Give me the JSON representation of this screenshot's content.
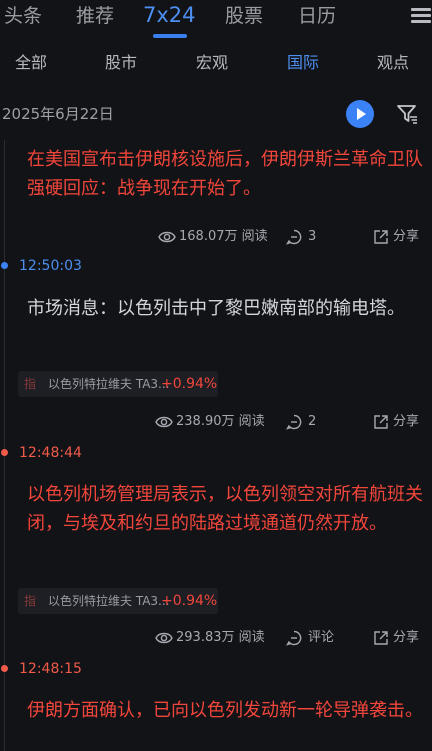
{
  "top_nav": {
    "tabs": [
      {
        "label": "头条",
        "active": false
      },
      {
        "label": "推荐",
        "active": false
      },
      {
        "label": "7x24",
        "active": true
      },
      {
        "label": "股票",
        "active": false
      },
      {
        "label": "日历",
        "active": false
      }
    ],
    "menu_icon": "hamburger-menu-icon"
  },
  "sub_nav": {
    "tabs": [
      {
        "label": "全部",
        "active": false
      },
      {
        "label": "股市",
        "active": false
      },
      {
        "label": "宏观",
        "active": false
      },
      {
        "label": "国际",
        "active": true
      },
      {
        "label": "观点",
        "active": false
      }
    ]
  },
  "date": "2025年6月22日",
  "toolbar": {
    "play_icon": "play-icon",
    "filter_icon": "filter-icon"
  },
  "colors": {
    "accent": "#3b82f6",
    "important": "#f2463b",
    "background": "#121317"
  },
  "news": [
    {
      "time": "",
      "important": true,
      "text": "在美国宣布击伊朗核设施后，伊朗伊斯兰革命卫队强硬回应：战争现在开始了。",
      "views": "168.07万 阅读",
      "comments": "3",
      "share": "分享"
    },
    {
      "time": "12:50:03",
      "important": false,
      "text": "市场消息：以色列击中了黎巴嫩南部的输电塔。",
      "stock": {
        "tag": "指",
        "name": "以色列特拉维夫 TA3...",
        "change": "+0.94%"
      },
      "views": "238.90万 阅读",
      "comments": "2",
      "share": "分享"
    },
    {
      "time": "12:48:44",
      "important": true,
      "text": "以色列机场管理局表示，以色列领空对所有航班关闭，与埃及和约旦的陆路过境通道仍然开放。",
      "stock": {
        "tag": "指",
        "name": "以色列特拉维夫 TA3...",
        "change": "+0.94%"
      },
      "views": "293.83万 阅读",
      "comments": "评论",
      "share": "分享"
    },
    {
      "time": "12:48:15",
      "important": true,
      "text": "伊朗方面确认，已向以色列发动新一轮导弹袭击。"
    }
  ]
}
